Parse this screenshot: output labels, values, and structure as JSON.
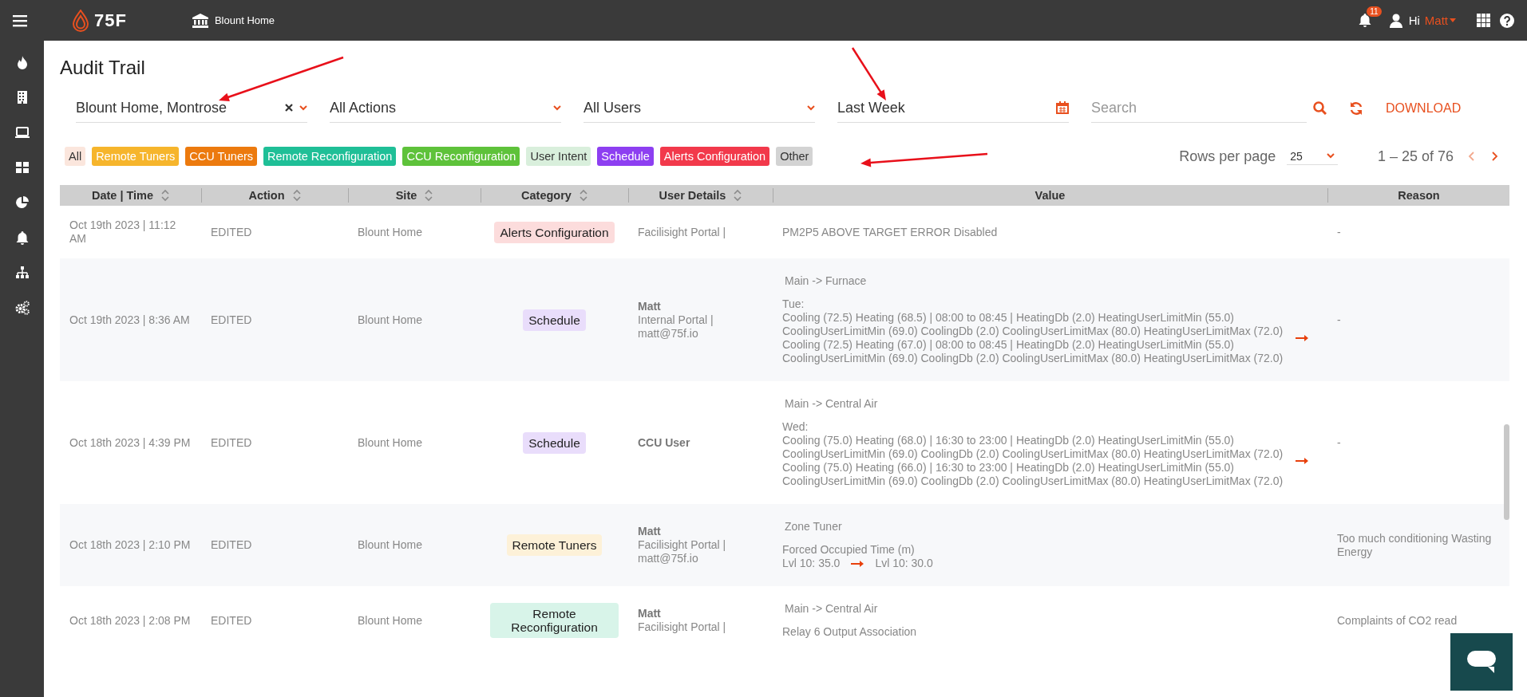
{
  "topbar": {
    "logo": "75F",
    "site": "Blount Home",
    "notifications": "11",
    "greeting": "Hi",
    "user": "Matt"
  },
  "page": {
    "title": "Audit Trail"
  },
  "filters": [
    {
      "kind": "select",
      "value": "Blount Home, Montrose",
      "clearable": true
    },
    {
      "kind": "select",
      "value": "All Actions",
      "clearable": false
    },
    {
      "kind": "select",
      "value": "All Users",
      "clearable": false
    },
    {
      "kind": "date",
      "value": "Last Week",
      "clearable": false
    },
    {
      "kind": "search",
      "placeholder": "Search",
      "clearable": false
    }
  ],
  "download": "DOWNLOAD",
  "chips": [
    {
      "label": "All",
      "color": "#fbe6dd",
      "dark_text": true
    },
    {
      "label": "Remote Tuners",
      "color": "#f6b52c",
      "dark_text": false
    },
    {
      "label": "CCU Tuners",
      "color": "#ec7a0e",
      "dark_text": false
    },
    {
      "label": "Remote Reconfiguration",
      "color": "#1fbf97",
      "dark_text": false
    },
    {
      "label": "CCU Reconfiguration",
      "color": "#5ec23a",
      "dark_text": false
    },
    {
      "label": "User Intent",
      "color": "#d9efdc",
      "dark_text": true
    },
    {
      "label": "Schedule",
      "color": "#8d3ff1",
      "dark_text": false
    },
    {
      "label": "Alerts Configuration",
      "color": "#f2394b",
      "dark_text": false
    },
    {
      "label": "Other",
      "color": "#d3d3d3",
      "dark_text": true
    }
  ],
  "pagination": {
    "rows_label": "Rows per page",
    "rows_value": "25",
    "range": "1 – 25 of 76",
    "prev_disabled": true
  },
  "table": {
    "columns": [
      {
        "label": "Date | Time",
        "sortable": true
      },
      {
        "label": "Action",
        "sortable": true
      },
      {
        "label": "Site",
        "sortable": true
      },
      {
        "label": "Category",
        "sortable": true
      },
      {
        "label": "User Details",
        "sortable": true
      },
      {
        "label": "Value",
        "sortable": false
      },
      {
        "label": "Reason",
        "sortable": false
      }
    ],
    "rows": [
      {
        "datetime": "Oct 19th 2023 | 11:12 AM",
        "action": "EDITED",
        "site": "Blount Home",
        "category": {
          "label": "Alerts Configuration",
          "color": "#fcdcdc"
        },
        "user_name": "",
        "user_portal": "Facilisight Portal |",
        "user_email": "",
        "value": {
          "kind": "plain",
          "text": "PM2P5 ABOVE TARGET ERROR Disabled"
        },
        "reason": "-"
      },
      {
        "datetime": "Oct 19th 2023 | 8:36 AM",
        "action": "EDITED",
        "site": "Blount Home",
        "category": {
          "label": "Schedule",
          "color": "#e9ddfb"
        },
        "user_name": "Matt",
        "user_portal": "Internal Portal |",
        "user_email": "matt@75f.io",
        "value": {
          "kind": "block-change",
          "heading": "Main -> Furnace",
          "label": "Tue:",
          "old": [
            "Cooling (72.5) Heating (68.5) | 08:00 to 08:45 | HeatingDb (2.0) HeatingUserLimitMin (55.0)",
            "CoolingUserLimitMin (69.0) CoolingDb (2.0) CoolingUserLimitMax (80.0) HeatingUserLimitMax (72.0)"
          ],
          "new": [
            "Cooling (72.5) Heating (67.0) | 08:00 to 08:45 | HeatingDb (2.0) HeatingUserLimitMin (55.0)",
            "CoolingUserLimitMin (69.0) CoolingDb (2.0) CoolingUserLimitMax (80.0) HeatingUserLimitMax (72.0)"
          ]
        },
        "reason": "-"
      },
      {
        "datetime": "Oct 18th 2023 | 4:39 PM",
        "action": "EDITED",
        "site": "Blount Home",
        "category": {
          "label": "Schedule",
          "color": "#e9ddfb"
        },
        "user_name": "CCU User",
        "user_portal": "",
        "user_email": "",
        "value": {
          "kind": "block-change",
          "heading": "Main -> Central Air",
          "label": "Wed:",
          "old": [
            "Cooling (75.0) Heating (68.0) | 16:30 to 23:00 | HeatingDb (2.0) HeatingUserLimitMin (55.0)",
            "CoolingUserLimitMin (69.0) CoolingDb (2.0) CoolingUserLimitMax (80.0) HeatingUserLimitMax (72.0)"
          ],
          "new": [
            "Cooling (75.0) Heating (66.0) | 16:30 to 23:00 | HeatingDb (2.0) HeatingUserLimitMin (55.0)",
            "CoolingUserLimitMin (69.0) CoolingDb (2.0) CoolingUserLimitMax (80.0) HeatingUserLimitMax (72.0)"
          ]
        },
        "reason": "-"
      },
      {
        "datetime": "Oct 18th 2023 | 2:10 PM",
        "action": "EDITED",
        "site": "Blount Home",
        "category": {
          "label": "Remote Tuners",
          "color": "#fdf1d8"
        },
        "user_name": "Matt",
        "user_portal": "Facilisight Portal |",
        "user_email": "matt@75f.io",
        "value": {
          "kind": "inline-change",
          "heading": "Zone Tuner",
          "label": "Forced Occupied Time (m)",
          "old": [
            "Lvl 10: 35.0"
          ],
          "new": [
            "Lvl 10: 30.0"
          ]
        },
        "reason": "Too much conditioning Wasting Energy"
      },
      {
        "datetime": "Oct 18th 2023 | 2:08 PM",
        "action": "EDITED",
        "site": "Blount Home",
        "category": {
          "label": "Remote Reconfiguration",
          "color": "#d8f4e9"
        },
        "user_name": "Matt",
        "user_portal": "Facilisight Portal |",
        "user_email": "",
        "value": {
          "kind": "heading-label",
          "heading": "Main -> Central Air",
          "label": "Relay 6 Output Association"
        },
        "reason": "Complaints of CO2 read"
      }
    ]
  }
}
